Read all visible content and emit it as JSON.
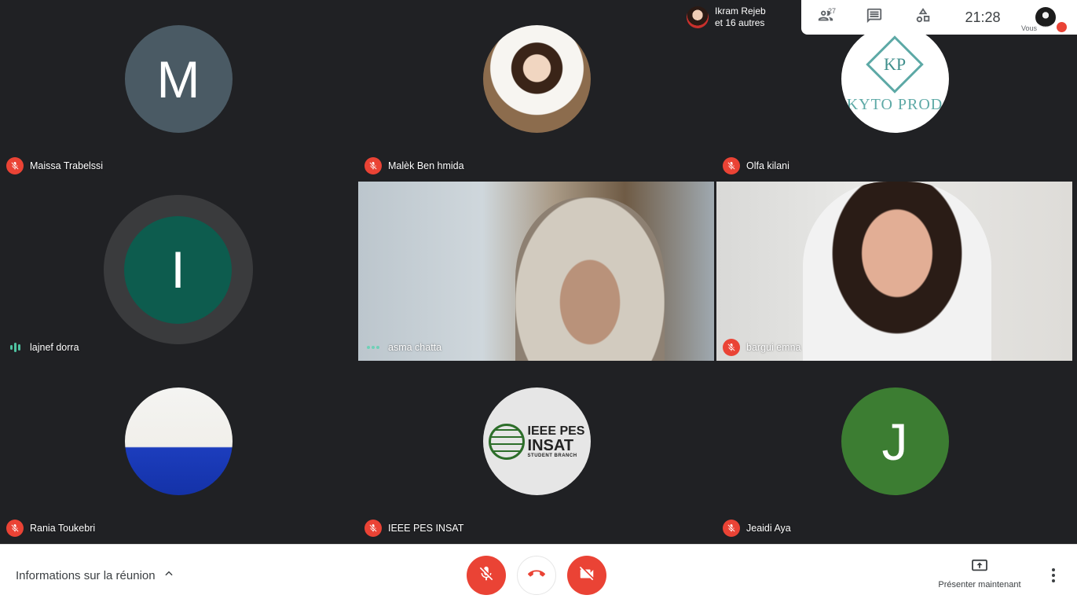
{
  "top_bar": {
    "participants_chip": {
      "name": "Ikram Rejeb",
      "others": "et 16 autres"
    },
    "participant_count": "27",
    "clock": "21:28",
    "self_label": "Vous"
  },
  "tiles": [
    {
      "name": "Maissa Trabelssi",
      "avatar_letter": "M",
      "status": "muted"
    },
    {
      "name": "Malèk Ben hmida",
      "status": "muted",
      "avatar": "photo"
    },
    {
      "name": "Olfa kilani",
      "status": "muted",
      "avatar": "logo",
      "logo_text": {
        "initials": "KP",
        "brand": "KYTO PROD"
      }
    },
    {
      "name": "lajnef dorra",
      "avatar_letter": "I",
      "status": "speaking"
    },
    {
      "name": "asma chatta",
      "status": "connecting",
      "avatar": "video"
    },
    {
      "name": "bargui emna",
      "status": "muted",
      "avatar": "video"
    },
    {
      "name": "Rania Toukebri",
      "status": "muted",
      "avatar": "photo"
    },
    {
      "name": "IEEE PES INSAT",
      "status": "muted",
      "avatar": "logo",
      "logo_text": {
        "line1": "IEEE PES",
        "line2": "INSAT",
        "line3": "STUDENT BRANCH"
      }
    },
    {
      "name": "Jeaidi Aya",
      "avatar_letter": "J",
      "status": "muted"
    }
  ],
  "bottom_bar": {
    "meeting_info_label": "Informations sur la réunion",
    "present_label": "Présenter maintenant"
  },
  "colors": {
    "stage_bg": "#202124",
    "muted_red": "#ea4335",
    "speaking_green": "#4fc3a1"
  }
}
